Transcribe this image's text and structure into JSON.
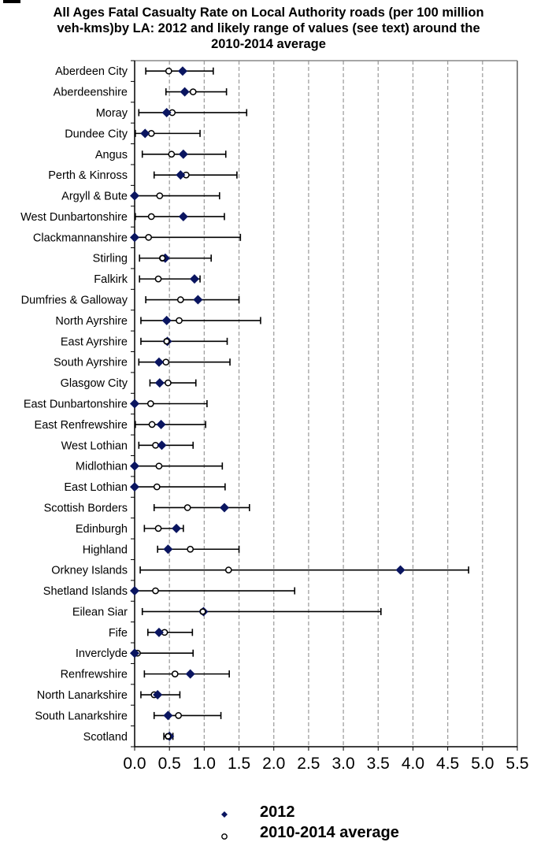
{
  "chart_data": {
    "type": "scatter",
    "subtype": "dot-plot-with-error-bars",
    "title_lines": [
      "All Ages Fatal Casualty Rate on Local Authority roads (per 100 million",
      "veh-kms)by LA: 2012 and likely range of values (see text) around the",
      "2010-2014 average"
    ],
    "xlabel": "",
    "ylabel": "",
    "xlim": [
      0,
      5.5
    ],
    "x_ticks": [
      "0.0",
      "0.5",
      "1.0",
      "1.5",
      "2.0",
      "2.5",
      "3.0",
      "3.5",
      "4.0",
      "4.5",
      "5.0",
      "5.5"
    ],
    "x_tick_values": [
      0,
      0.5,
      1.0,
      1.5,
      2.0,
      2.5,
      3.0,
      3.5,
      4.0,
      4.5,
      5.0,
      5.5
    ],
    "grid": "vertical dashed",
    "legend_position": "bottom",
    "colors": {
      "series_2012": "#0a1560",
      "average_fill": "#ffffff",
      "average_stroke": "#000000",
      "error_bar": "#000000",
      "grid": "#a0a0a0"
    },
    "categories": [
      "Aberdeen City",
      "Aberdeenshire",
      "Moray",
      "Dundee City",
      "Angus",
      "Perth & Kinross",
      "Argyll & Bute",
      "West Dunbartonshire",
      "Clackmannanshire",
      "Stirling",
      "Falkirk",
      "Dumfries & Galloway",
      "North Ayrshire",
      "East Ayrshire",
      "South Ayrshire",
      "Glasgow City",
      "East Dunbartonshire",
      "East Renfrewshire",
      "West Lothian",
      "Midlothian",
      "East Lothian",
      "Scottish Borders",
      "Edinburgh",
      "Highland",
      "Orkney Islands",
      "Shetland Islands",
      "Eilean Siar",
      "Fife",
      "Inverclyde",
      "Renfrewshire",
      "North Lanarkshire",
      "South Lanarkshire",
      "Scotland"
    ],
    "series": [
      {
        "name": "2012",
        "marker": "diamond",
        "values": [
          0.69,
          0.72,
          0.46,
          0.15,
          0.7,
          0.66,
          0.0,
          0.7,
          0.0,
          0.44,
          0.86,
          0.91,
          0.46,
          0.47,
          0.35,
          0.36,
          0.0,
          0.38,
          0.39,
          0.0,
          0.0,
          1.29,
          0.6,
          0.48,
          3.82,
          0.0,
          0.99,
          0.35,
          0.0,
          0.8,
          0.33,
          0.48,
          0.5
        ]
      },
      {
        "name": "2010-2014 average",
        "marker": "open-circle",
        "values": [
          0.49,
          0.84,
          0.54,
          0.24,
          0.53,
          0.74,
          0.36,
          0.24,
          0.2,
          0.4,
          0.34,
          0.66,
          0.64,
          0.46,
          0.45,
          0.48,
          0.23,
          0.25,
          0.3,
          0.35,
          0.32,
          0.76,
          0.34,
          0.8,
          1.35,
          0.3,
          0.98,
          0.43,
          0.04,
          0.58,
          0.28,
          0.63,
          0.48
        ],
        "error_low": [
          0.16,
          0.45,
          0.06,
          0.01,
          0.11,
          0.28,
          0.0,
          0.01,
          0.0,
          0.07,
          0.07,
          0.16,
          0.09,
          0.09,
          0.06,
          0.22,
          0.0,
          0.01,
          0.06,
          0.0,
          0.0,
          0.28,
          0.14,
          0.33,
          0.08,
          0.0,
          0.11,
          0.19,
          0.0,
          0.14,
          0.09,
          0.28,
          0.42
        ],
        "error_high": [
          1.13,
          1.32,
          1.61,
          0.94,
          1.31,
          1.47,
          1.22,
          1.29,
          1.52,
          1.1,
          0.94,
          1.5,
          1.81,
          1.33,
          1.37,
          0.88,
          1.04,
          1.02,
          0.84,
          1.26,
          1.3,
          1.65,
          0.7,
          1.5,
          4.8,
          2.3,
          3.54,
          0.83,
          0.84,
          1.36,
          0.65,
          1.24,
          0.55
        ]
      }
    ]
  },
  "legend": {
    "items": [
      {
        "label": "2012",
        "symbol": "diamond"
      },
      {
        "label": "2010-2014 average",
        "symbol": "open-circle"
      }
    ]
  }
}
